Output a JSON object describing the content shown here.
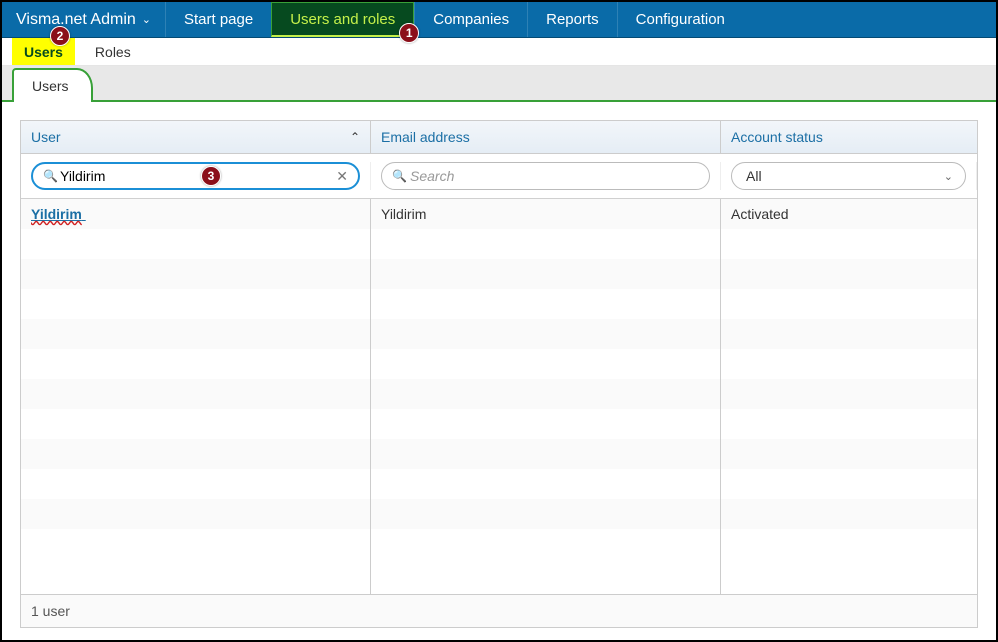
{
  "brand": {
    "title": "Visma.net Admin"
  },
  "nav": {
    "items": [
      {
        "label": "Start page"
      },
      {
        "label": "Users and roles",
        "active": true
      },
      {
        "label": "Companies"
      },
      {
        "label": "Reports"
      },
      {
        "label": "Configuration"
      }
    ]
  },
  "subnav": {
    "items": [
      {
        "label": "Users",
        "active": true
      },
      {
        "label": "Roles"
      }
    ]
  },
  "tab": {
    "label": "Users"
  },
  "columns": {
    "user": {
      "header": "User",
      "search_value": "Yildirim",
      "placeholder": "Search"
    },
    "email": {
      "header": "Email address",
      "search_value": "",
      "placeholder": "Search"
    },
    "status": {
      "header": "Account status",
      "selected": "All"
    }
  },
  "rows": [
    {
      "user": "Yildirim",
      "email": "Yildirim",
      "status": "Activated"
    }
  ],
  "footer": {
    "count": "1 user"
  },
  "annotations": {
    "b1": "1",
    "b2": "2",
    "b3": "3"
  }
}
